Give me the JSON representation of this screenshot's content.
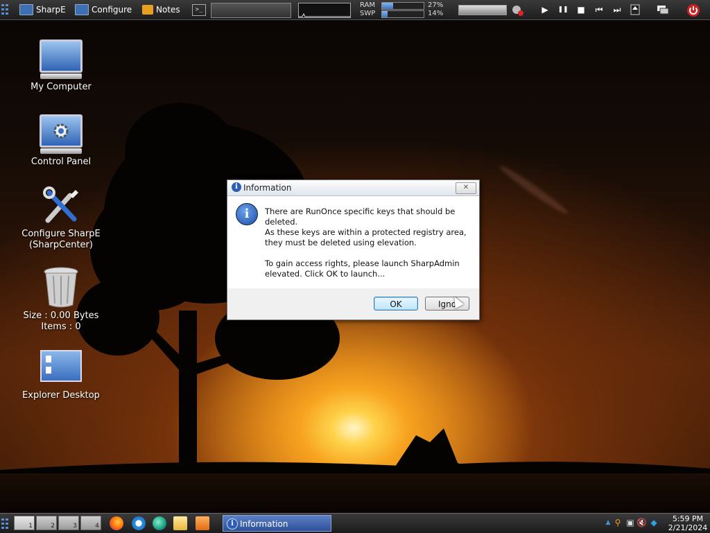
{
  "topbar": {
    "menu_icon": "app-grid-icon",
    "sharpe_label": "SharpE",
    "configure_label": "Configure",
    "notes_label": "Notes",
    "terminal_symbol": ">_",
    "ram_label": "RAM",
    "ram_value": "27%",
    "ram_fraction": 0.27,
    "swp_label": "SWP",
    "swp_value": "14%",
    "swp_fraction": 0.14,
    "media": {
      "play": "▶",
      "pause": "❚❚",
      "stop": "■",
      "prev": "⏮",
      "next": "⏭"
    },
    "power_icon": "power-icon"
  },
  "desktop_icons": [
    {
      "label": "My Computer"
    },
    {
      "label": "Control Panel"
    },
    {
      "label": "Configure SharpE",
      "label2": "(SharpCenter)"
    },
    {
      "label": "Size : 0.00 Bytes",
      "label2": "Items : 0"
    },
    {
      "label": "Explorer Desktop"
    }
  ],
  "dialog": {
    "title": "Information",
    "close_symbol": "✕",
    "message1": "There are RunOnce specific keys that should be deleted.",
    "message2": "As these keys are within a protected registry area, they must be deleted using elevation.",
    "message3": "To gain access rights, please launch SharpAdmin elevated. Click OK to launch...",
    "ok_label": "OK",
    "ignore_label": "Igno"
  },
  "taskbar": {
    "workspaces": [
      "1",
      "2",
      "3",
      "4"
    ],
    "active_workspace": "1",
    "task_label": "Information",
    "clock_time": "5:59 PM",
    "clock_date": "2/21/2024"
  },
  "colors": {
    "accent": "#2d4f98",
    "info_blue": "#2c5fb4",
    "power_red": "#d02020"
  }
}
